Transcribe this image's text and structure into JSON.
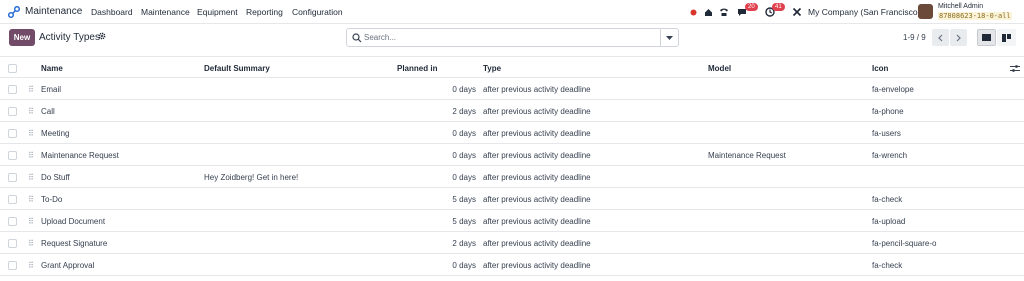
{
  "navbar": {
    "app_name": "Maintenance",
    "menu": [
      "Dashboard",
      "Maintenance",
      "Equipment",
      "Reporting",
      "Configuration"
    ],
    "chat_badge": "20",
    "activity_badge": "41",
    "company": "My Company (San Francisco)",
    "user_name": "Mitchell Admin",
    "db_name": "87808623-18-0-all"
  },
  "control": {
    "new_label": "New",
    "title": "Activity Types",
    "search_placeholder": "Search...",
    "pager": "1-9 / 9"
  },
  "table": {
    "headers": {
      "name": "Name",
      "summary": "Default Summary",
      "planned": "Planned in",
      "type": "Type",
      "model": "Model",
      "icon": "Icon"
    },
    "rows": [
      {
        "name": "Email",
        "summary": "",
        "planned": "0 days",
        "type": "after previous activity deadline",
        "model": "",
        "icon": "fa-envelope"
      },
      {
        "name": "Call",
        "summary": "",
        "planned": "2 days",
        "type": "after previous activity deadline",
        "model": "",
        "icon": "fa-phone"
      },
      {
        "name": "Meeting",
        "summary": "",
        "planned": "0 days",
        "type": "after previous activity deadline",
        "model": "",
        "icon": "fa-users"
      },
      {
        "name": "Maintenance Request",
        "summary": "",
        "planned": "0 days",
        "type": "after previous activity deadline",
        "model": "Maintenance Request",
        "icon": "fa-wrench"
      },
      {
        "name": "Do Stuff",
        "summary": "Hey Zoidberg! Get in here!",
        "planned": "0 days",
        "type": "after previous activity deadline",
        "model": "",
        "icon": ""
      },
      {
        "name": "To-Do",
        "summary": "",
        "planned": "5 days",
        "type": "after previous activity deadline",
        "model": "",
        "icon": "fa-check"
      },
      {
        "name": "Upload Document",
        "summary": "",
        "planned": "5 days",
        "type": "after previous activity deadline",
        "model": "",
        "icon": "fa-upload"
      },
      {
        "name": "Request Signature",
        "summary": "",
        "planned": "2 days",
        "type": "after previous activity deadline",
        "model": "",
        "icon": "fa-pencil-square-o"
      },
      {
        "name": "Grant Approval",
        "summary": "",
        "planned": "0 days",
        "type": "after previous activity deadline",
        "model": "",
        "icon": "fa-check"
      }
    ]
  },
  "colors": {
    "brand": "#714b67",
    "badge": "#e0414e",
    "record_dot": "#d9362b"
  }
}
